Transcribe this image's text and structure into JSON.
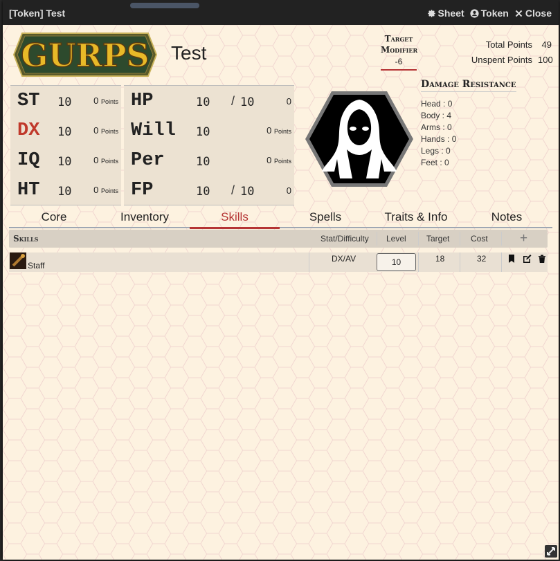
{
  "window": {
    "title": "[Token] Test",
    "buttons": {
      "sheet": "Sheet",
      "token": "Token",
      "close": "Close"
    }
  },
  "header": {
    "logo_text": "GURPS",
    "character_name": "Test",
    "target_modifier": {
      "label_line1": "Target",
      "label_line2": "Modifier",
      "value": "-6"
    },
    "total_points_label": "Total Points",
    "total_points": "49",
    "unspent_points_label": "Unspent Points",
    "unspent_points": "100"
  },
  "attributes": [
    {
      "abbr": "ST",
      "value": "10",
      "points": "0",
      "points_label": "Points"
    },
    {
      "abbr": "DX",
      "value": "10",
      "points": "0",
      "points_label": "Points"
    },
    {
      "abbr": "IQ",
      "value": "10",
      "points": "0",
      "points_label": "Points"
    },
    {
      "abbr": "HT",
      "value": "10",
      "points": "0",
      "points_label": "Points"
    }
  ],
  "secondary": [
    {
      "abbr": "HP",
      "value": "10",
      "slash": "/",
      "max": "10",
      "extra": "0"
    },
    {
      "abbr": "Will",
      "value": "10",
      "points": "0",
      "points_label": "Points"
    },
    {
      "abbr": "Per",
      "value": "10",
      "points": "0",
      "points_label": "Points"
    },
    {
      "abbr": "FP",
      "value": "10",
      "slash": "/",
      "max": "10",
      "extra": "0"
    }
  ],
  "damage_resistance": {
    "title": "Damage Resistance",
    "lines": [
      "Head : 0",
      "Body : 4",
      "Arms : 0",
      "Hands : 0",
      "Legs : 0",
      "Feet : 0"
    ]
  },
  "tabs": [
    "Core",
    "Inventory",
    "Skills",
    "Spells",
    "Traits & Info",
    "Notes"
  ],
  "active_tab": "Skills",
  "skills_table": {
    "section": "Skills",
    "headers": {
      "stat": "Stat/Difficulty",
      "level": "Level",
      "target": "Target",
      "cost": "Cost",
      "add": "+"
    },
    "rows": [
      {
        "name": "Staff",
        "stat": "DX/AV",
        "level": "10",
        "target": "18",
        "cost": "32"
      }
    ]
  },
  "colors": {
    "accent": "#b53434",
    "background": "#fdf2e0",
    "titlebar": "#222222"
  }
}
